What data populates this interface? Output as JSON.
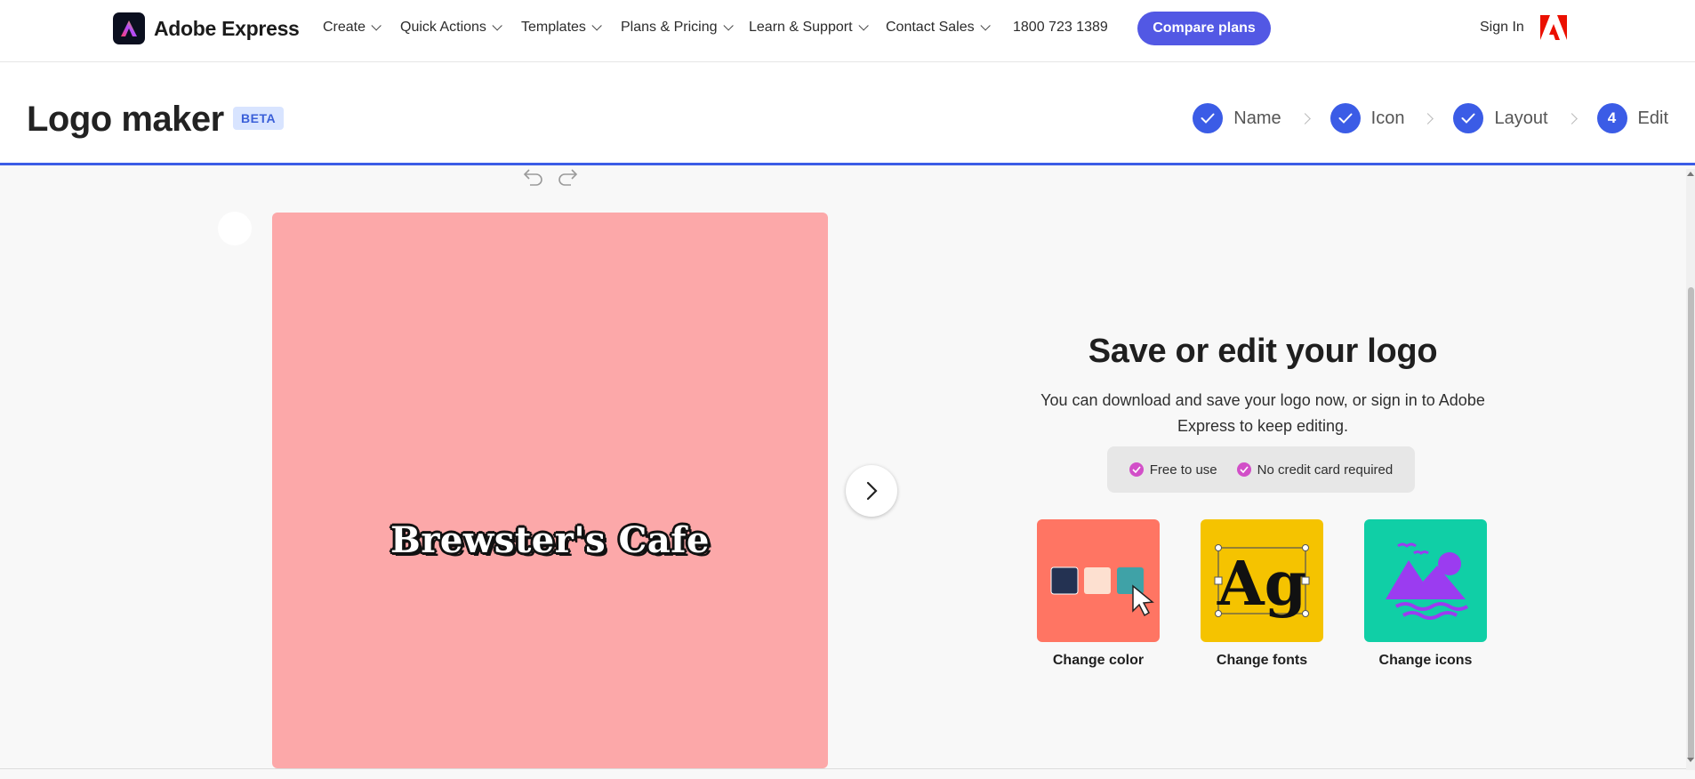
{
  "nav": {
    "brand": "Adobe Express",
    "items": [
      {
        "label": "Create"
      },
      {
        "label": "Quick Actions"
      },
      {
        "label": "Templates"
      },
      {
        "label": "Plans & Pricing"
      },
      {
        "label": "Learn & Support"
      },
      {
        "label": "Contact Sales"
      }
    ],
    "phone": "1800 723 1389",
    "compare_label": "Compare plans",
    "signin_label": "Sign In",
    "accent": "#5258e4"
  },
  "header": {
    "title": "Logo maker",
    "badge": "BETA",
    "steps": [
      {
        "label": "Name",
        "done": true
      },
      {
        "label": "Icon",
        "done": true
      },
      {
        "label": "Layout",
        "done": true
      },
      {
        "number": "4",
        "label": "Edit",
        "done": false
      }
    ],
    "accent": "#3b5ce6"
  },
  "canvas": {
    "logo_text": "Brewster's Cafe",
    "background": "#fca8a9"
  },
  "panel": {
    "title": "Save or edit your logo",
    "description": "You can download and save your logo now, or sign in to Adobe Express to keep editing.",
    "perks": [
      "Free to use",
      "No credit card required"
    ],
    "tiles": [
      {
        "label": "Change color",
        "color": "#ff7563"
      },
      {
        "label": "Change fonts",
        "glyphs": "Ag",
        "color": "#f5c300"
      },
      {
        "label": "Change icons",
        "color": "#10cfa6"
      }
    ]
  }
}
